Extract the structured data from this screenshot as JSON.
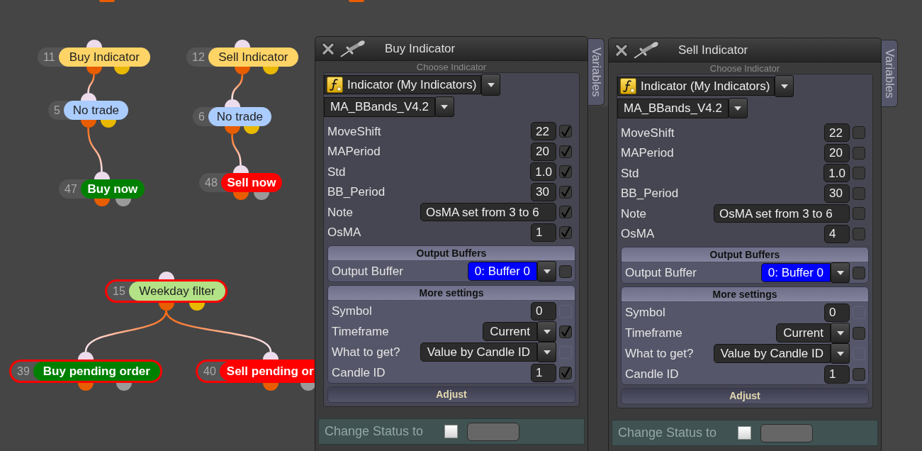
{
  "canvas": {
    "nodes": [
      {
        "number": "11",
        "label": "Buy Indicator",
        "kind": "condition",
        "color": "#ffd466",
        "selected": false,
        "children": [
          {
            "number": "5",
            "label": "No trade",
            "kind": "condition",
            "color": "#aaccff",
            "selected": false,
            "children": [
              {
                "number": "47",
                "label": "Buy now",
                "kind": "action",
                "color": "#008000",
                "selected": false
              }
            ]
          }
        ]
      },
      {
        "number": "12",
        "label": "Sell Indicator",
        "kind": "condition",
        "color": "#ffd466",
        "selected": false,
        "children": [
          {
            "number": "6",
            "label": "No trade",
            "kind": "condition",
            "color": "#aaccff",
            "selected": false,
            "children": [
              {
                "number": "48",
                "label": "Sell now",
                "kind": "action",
                "color": "#ff0000",
                "selected": false
              }
            ]
          }
        ]
      },
      {
        "number": "15",
        "label": "Weekday filter",
        "kind": "condition",
        "color": "#b3e286",
        "selected": true,
        "children": [
          {
            "number": "39",
            "label": "Buy pending order",
            "kind": "action",
            "color": "#008000",
            "selected": true
          },
          {
            "number": "40",
            "label": "Sell pending or",
            "kind": "action",
            "color": "#ff0000",
            "selected": true
          }
        ]
      }
    ]
  },
  "panels": [
    {
      "title": "Buy Indicator",
      "side_tab": "Variables",
      "group_title": "Choose Indicator",
      "indicator_type": "Indicator (My Indicators)",
      "indicator": "MA_BBands_V4.2",
      "params": [
        {
          "label": "MoveShift",
          "kind": "number",
          "value": "22",
          "checked": true
        },
        {
          "label": "MAPeriod",
          "kind": "number",
          "value": "20",
          "checked": true
        },
        {
          "label": "Std",
          "kind": "number",
          "value": "1.0",
          "checked": true
        },
        {
          "label": "BB_Period",
          "kind": "number",
          "value": "30",
          "checked": true
        },
        {
          "label": "Note",
          "kind": "text",
          "value": "OsMA set from 3 to 6",
          "checked": true
        },
        {
          "label": "OsMA",
          "kind": "number",
          "value": "1",
          "checked": true
        }
      ],
      "sections": [
        {
          "title": "Output Buffers",
          "expanded": true,
          "rows": [
            {
              "label": "Output Buffer",
              "kind": "dropdown",
              "value": "0: Buffer 0",
              "focused": true,
              "checked": false,
              "disabled": false
            }
          ]
        },
        {
          "title": "More settings",
          "expanded": true,
          "rows": [
            {
              "label": "Symbol",
              "kind": "number",
              "value": "0",
              "focused": false,
              "checked": false,
              "disabled": true
            },
            {
              "label": "Timeframe",
              "kind": "dropdown",
              "value": "Current",
              "focused": false,
              "checked": true,
              "disabled": false
            },
            {
              "label": "What to get?",
              "kind": "dropdown",
              "value": "Value by Candle ID",
              "focused": false,
              "checked": false,
              "disabled": true
            },
            {
              "label": "Candle ID",
              "kind": "number",
              "value": "1",
              "focused": false,
              "checked": true,
              "disabled": false
            }
          ]
        },
        {
          "title": "Adjust",
          "expanded": false
        }
      ],
      "status": {
        "label": "Change Status to",
        "checked": false
      }
    },
    {
      "title": "Sell Indicator",
      "side_tab": "Variables",
      "group_title": "Choose Indicator",
      "indicator_type": "Indicator (My Indicators)",
      "indicator": "MA_BBands_V4.2",
      "params": [
        {
          "label": "MoveShift",
          "kind": "number",
          "value": "22",
          "checked": false
        },
        {
          "label": "MAPeriod",
          "kind": "number",
          "value": "20",
          "checked": false
        },
        {
          "label": "Std",
          "kind": "number",
          "value": "1.0",
          "checked": false
        },
        {
          "label": "BB_Period",
          "kind": "number",
          "value": "30",
          "checked": false
        },
        {
          "label": "Note",
          "kind": "text",
          "value": "OsMA set from 3 to 6",
          "checked": false
        },
        {
          "label": "OsMA",
          "kind": "number",
          "value": "4",
          "checked": false
        }
      ],
      "sections": [
        {
          "title": "Output Buffers",
          "expanded": true,
          "rows": [
            {
              "label": "Output Buffer",
              "kind": "dropdown",
              "value": "0: Buffer 0",
              "focused": true,
              "checked": false,
              "disabled": false
            }
          ]
        },
        {
          "title": "More settings",
          "expanded": true,
          "rows": [
            {
              "label": "Symbol",
              "kind": "number",
              "value": "0",
              "focused": false,
              "checked": false,
              "disabled": true
            },
            {
              "label": "Timeframe",
              "kind": "dropdown",
              "value": "Current",
              "focused": false,
              "checked": false,
              "disabled": false
            },
            {
              "label": "What to get?",
              "kind": "dropdown",
              "value": "Value by Candle ID",
              "focused": false,
              "checked": false,
              "disabled": true
            },
            {
              "label": "Candle ID",
              "kind": "number",
              "value": "1",
              "focused": false,
              "checked": false,
              "disabled": false
            }
          ]
        },
        {
          "title": "Adjust",
          "expanded": false
        }
      ],
      "status": {
        "label": "Change Status to",
        "checked": false
      }
    }
  ]
}
